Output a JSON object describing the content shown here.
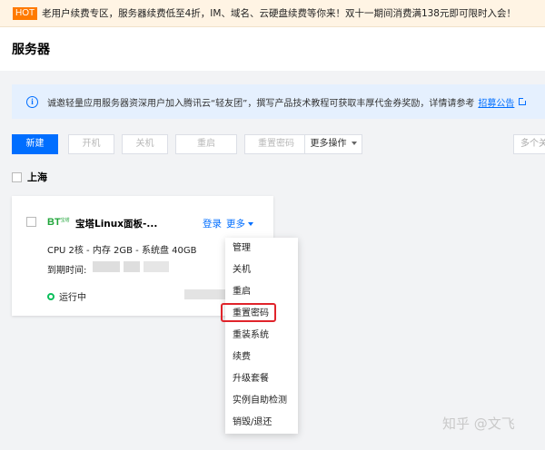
{
  "promo": {
    "badge": "HOT",
    "text": "老用户续费专区，服务器续费低至4折，IM、域名、云硬盘续费等你来！双十一期间消费满138元即可限时入会！"
  },
  "header": {
    "title": "服务器"
  },
  "notice": {
    "icon": "info-icon",
    "text": "诚邀轻量应用服务器资深用户加入腾讯云“轻友团”，撰写产品技术教程可获取丰厚代金券奖励，详情请参考",
    "link": "招募公告"
  },
  "toolbar": {
    "new": "新建",
    "power_on": "开机",
    "power_off": "关机",
    "restart": "重启",
    "reset_password": "重置密码",
    "more_actions": "更多操作",
    "filter_placeholder": "多个关"
  },
  "region": {
    "label": "上海"
  },
  "instance": {
    "logo": "BT",
    "logo_small": "宝塔",
    "name": "宝塔Linux面板-...",
    "login": "登录",
    "more": "更多",
    "spec": "CPU 2核 - 内存 2GB - 系统盘 40GB",
    "expiry_label": "到期时间:",
    "status": "运行中"
  },
  "menu": {
    "items": [
      "管理",
      "关机",
      "重启",
      "重置密码",
      "重装系统",
      "续费",
      "升级套餐",
      "实例自助检测",
      "销毁/退还"
    ],
    "highlighted": "重置密码"
  },
  "colors": {
    "accent": "#006eff",
    "running": "#0abf5b",
    "highlight_border": "#e0242b",
    "hot_badge": "#ff7a00"
  },
  "watermark": "知乎 @文飞"
}
